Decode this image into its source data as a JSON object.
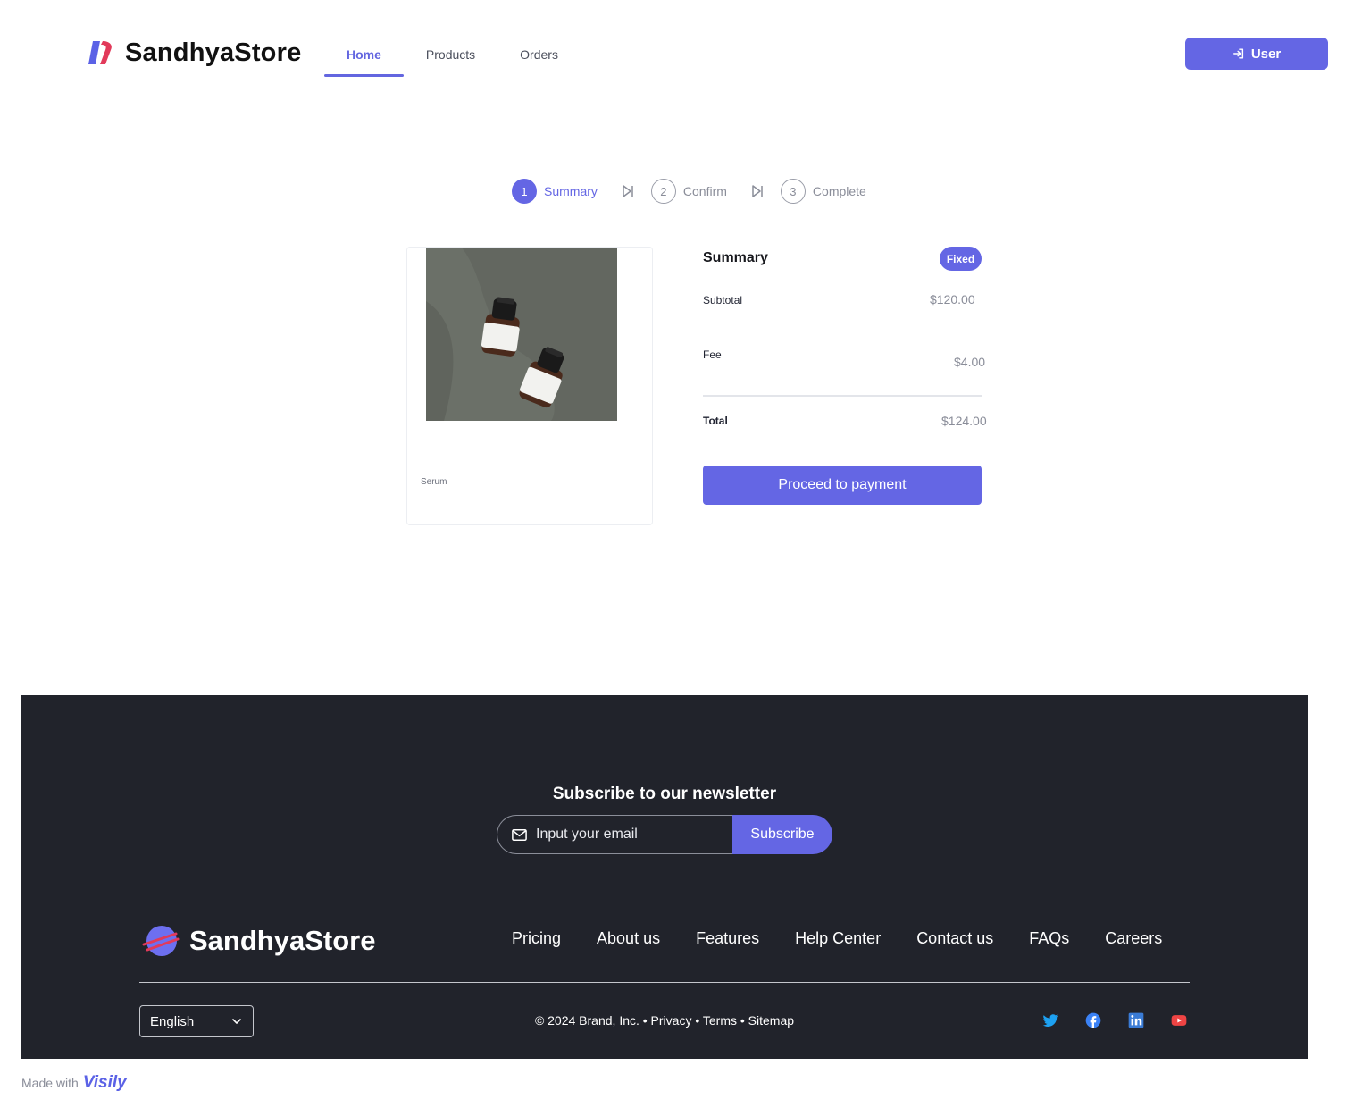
{
  "header": {
    "brand": "SandhyaStore",
    "nav": [
      "Home",
      "Products",
      "Orders"
    ],
    "active_nav": "Home",
    "user_button": "User",
    "brand_color": "#6466e4"
  },
  "stepper": {
    "steps": [
      {
        "number": "1",
        "label": "Summary"
      },
      {
        "number": "2",
        "label": "Confirm"
      },
      {
        "number": "3",
        "label": "Complete"
      }
    ],
    "active_step": 1
  },
  "product": {
    "name": "Serum"
  },
  "summary": {
    "title": "Summary",
    "badge": "Fixed",
    "rows": [
      {
        "label": "Subtotal",
        "value": "$120.00"
      },
      {
        "label": "Fee",
        "value": "$4.00"
      }
    ],
    "total_label": "Total",
    "total_value": "$124.00",
    "pay_button": "Proceed to payment"
  },
  "footer": {
    "newsletter_title": "Subscribe to our newsletter",
    "email_placeholder": "Input your email",
    "subscribe_button": "Subscribe",
    "brand": "SandhyaStore",
    "links": [
      "Pricing",
      "About us",
      "Features",
      "Help Center",
      "Contact us",
      "FAQs",
      "Careers"
    ],
    "language": "English",
    "legal": "© 2024 Brand, Inc. • Privacy • Terms • Sitemap",
    "socials": [
      "twitter-icon",
      "facebook-icon",
      "linkedin-icon",
      "youtube-icon"
    ],
    "background": "#21232b"
  },
  "made_with": {
    "text": "Made with",
    "logo_text": "Visily"
  }
}
